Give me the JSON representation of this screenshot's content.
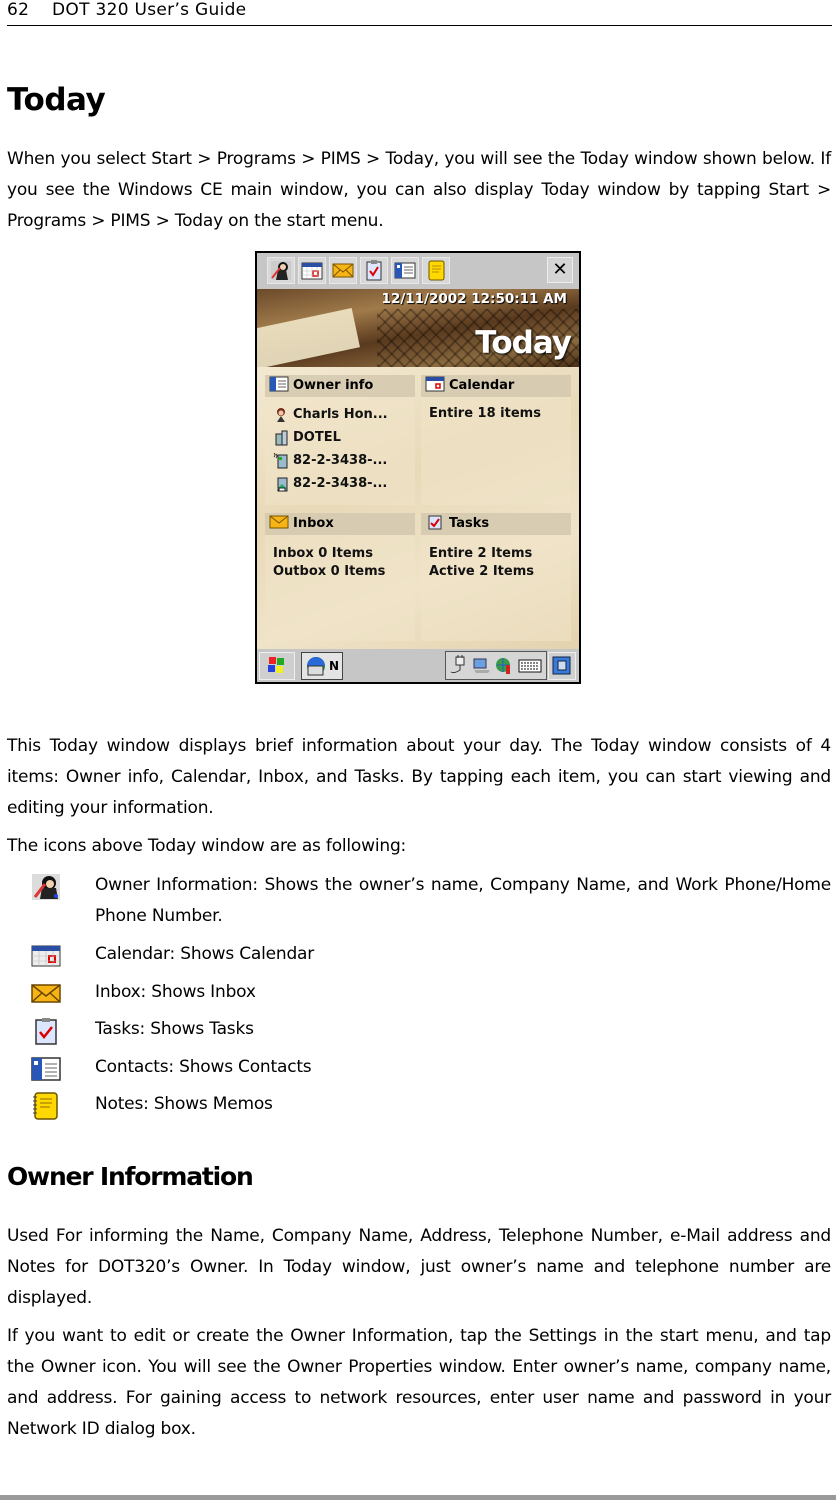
{
  "header": {
    "page_number": "62",
    "title": "DOT 320 User’s Guide"
  },
  "section_today": {
    "heading": "Today",
    "intro": "When you select Start > Programs > PIMS > Today, you will see the Today window shown below. If you see the Windows CE main window, you can also display Today window by tapping Start > Programs > PIMS > Today on the start menu.",
    "description": "This Today window displays brief information about your day. The Today window consists of 4 items: Owner info, Calendar, Inbox, and Tasks. By tapping each item, you can start viewing and editing your information.",
    "icons_intro": "The icons above Today window are as following:",
    "icon_list": [
      {
        "icon": "owner-info-icon",
        "text": "Owner Information: Shows the owner’s name, Company Name, and Work Phone/Home Phone Number."
      },
      {
        "icon": "calendar-icon",
        "text": "Calendar: Shows Calendar"
      },
      {
        "icon": "inbox-icon",
        "text": "Inbox: Shows Inbox"
      },
      {
        "icon": "tasks-icon",
        "text": "Tasks: Shows Tasks"
      },
      {
        "icon": "contacts-icon",
        "text": "Contacts: Shows Contacts"
      },
      {
        "icon": "notes-icon",
        "text": "Notes: Shows Memos"
      }
    ]
  },
  "device_screen": {
    "toolbar_icons": [
      "owner-info-icon",
      "calendar-icon",
      "inbox-icon",
      "tasks-icon",
      "contacts-icon",
      "notes-icon"
    ],
    "close_label": "✕",
    "datetime": "12/11/2002 12:50:11 AM",
    "title": "Today",
    "panels": {
      "owner_info": {
        "title": "Owner info",
        "rows": [
          {
            "icon": "person-icon",
            "text": "Charls Hon..."
          },
          {
            "icon": "company-icon",
            "text": "DOTEL"
          },
          {
            "icon": "work-phone-icon",
            "text": "82-2-3438-..."
          },
          {
            "icon": "home-phone-icon",
            "text": "82-2-3438-..."
          }
        ]
      },
      "calendar": {
        "title": "Calendar",
        "lines": [
          "Entire 18 items"
        ]
      },
      "inbox": {
        "title": "Inbox",
        "lines": [
          "Inbox 0 Items",
          "Outbox 0 Items"
        ]
      },
      "tasks": {
        "title": "Tasks",
        "lines": [
          "Entire 2 Items",
          "Active 2 Items"
        ]
      }
    },
    "taskbar": {
      "start_icon": "windows-start-icon",
      "active_app_label": "N",
      "tray_icons": [
        "power-plug-icon",
        "network-icon",
        "connection-icon",
        "keyboard-icon"
      ],
      "desktop_icon": "show-desktop-icon"
    }
  },
  "section_owner": {
    "heading": "Owner Information",
    "para1": "Used For informing the Name, Company Name, Address, Telephone Number, e-Mail address and Notes for DOT320’s Owner. In Today window, just owner’s name and telephone number are displayed.",
    "para2": "If you want to edit or create the Owner Information, tap the Settings in the start menu, and tap the Owner icon. You will see the Owner Properties window. Enter owner’s name, company name, and address. For gaining access to network resources, enter user name and password in your Network ID dialog box."
  }
}
